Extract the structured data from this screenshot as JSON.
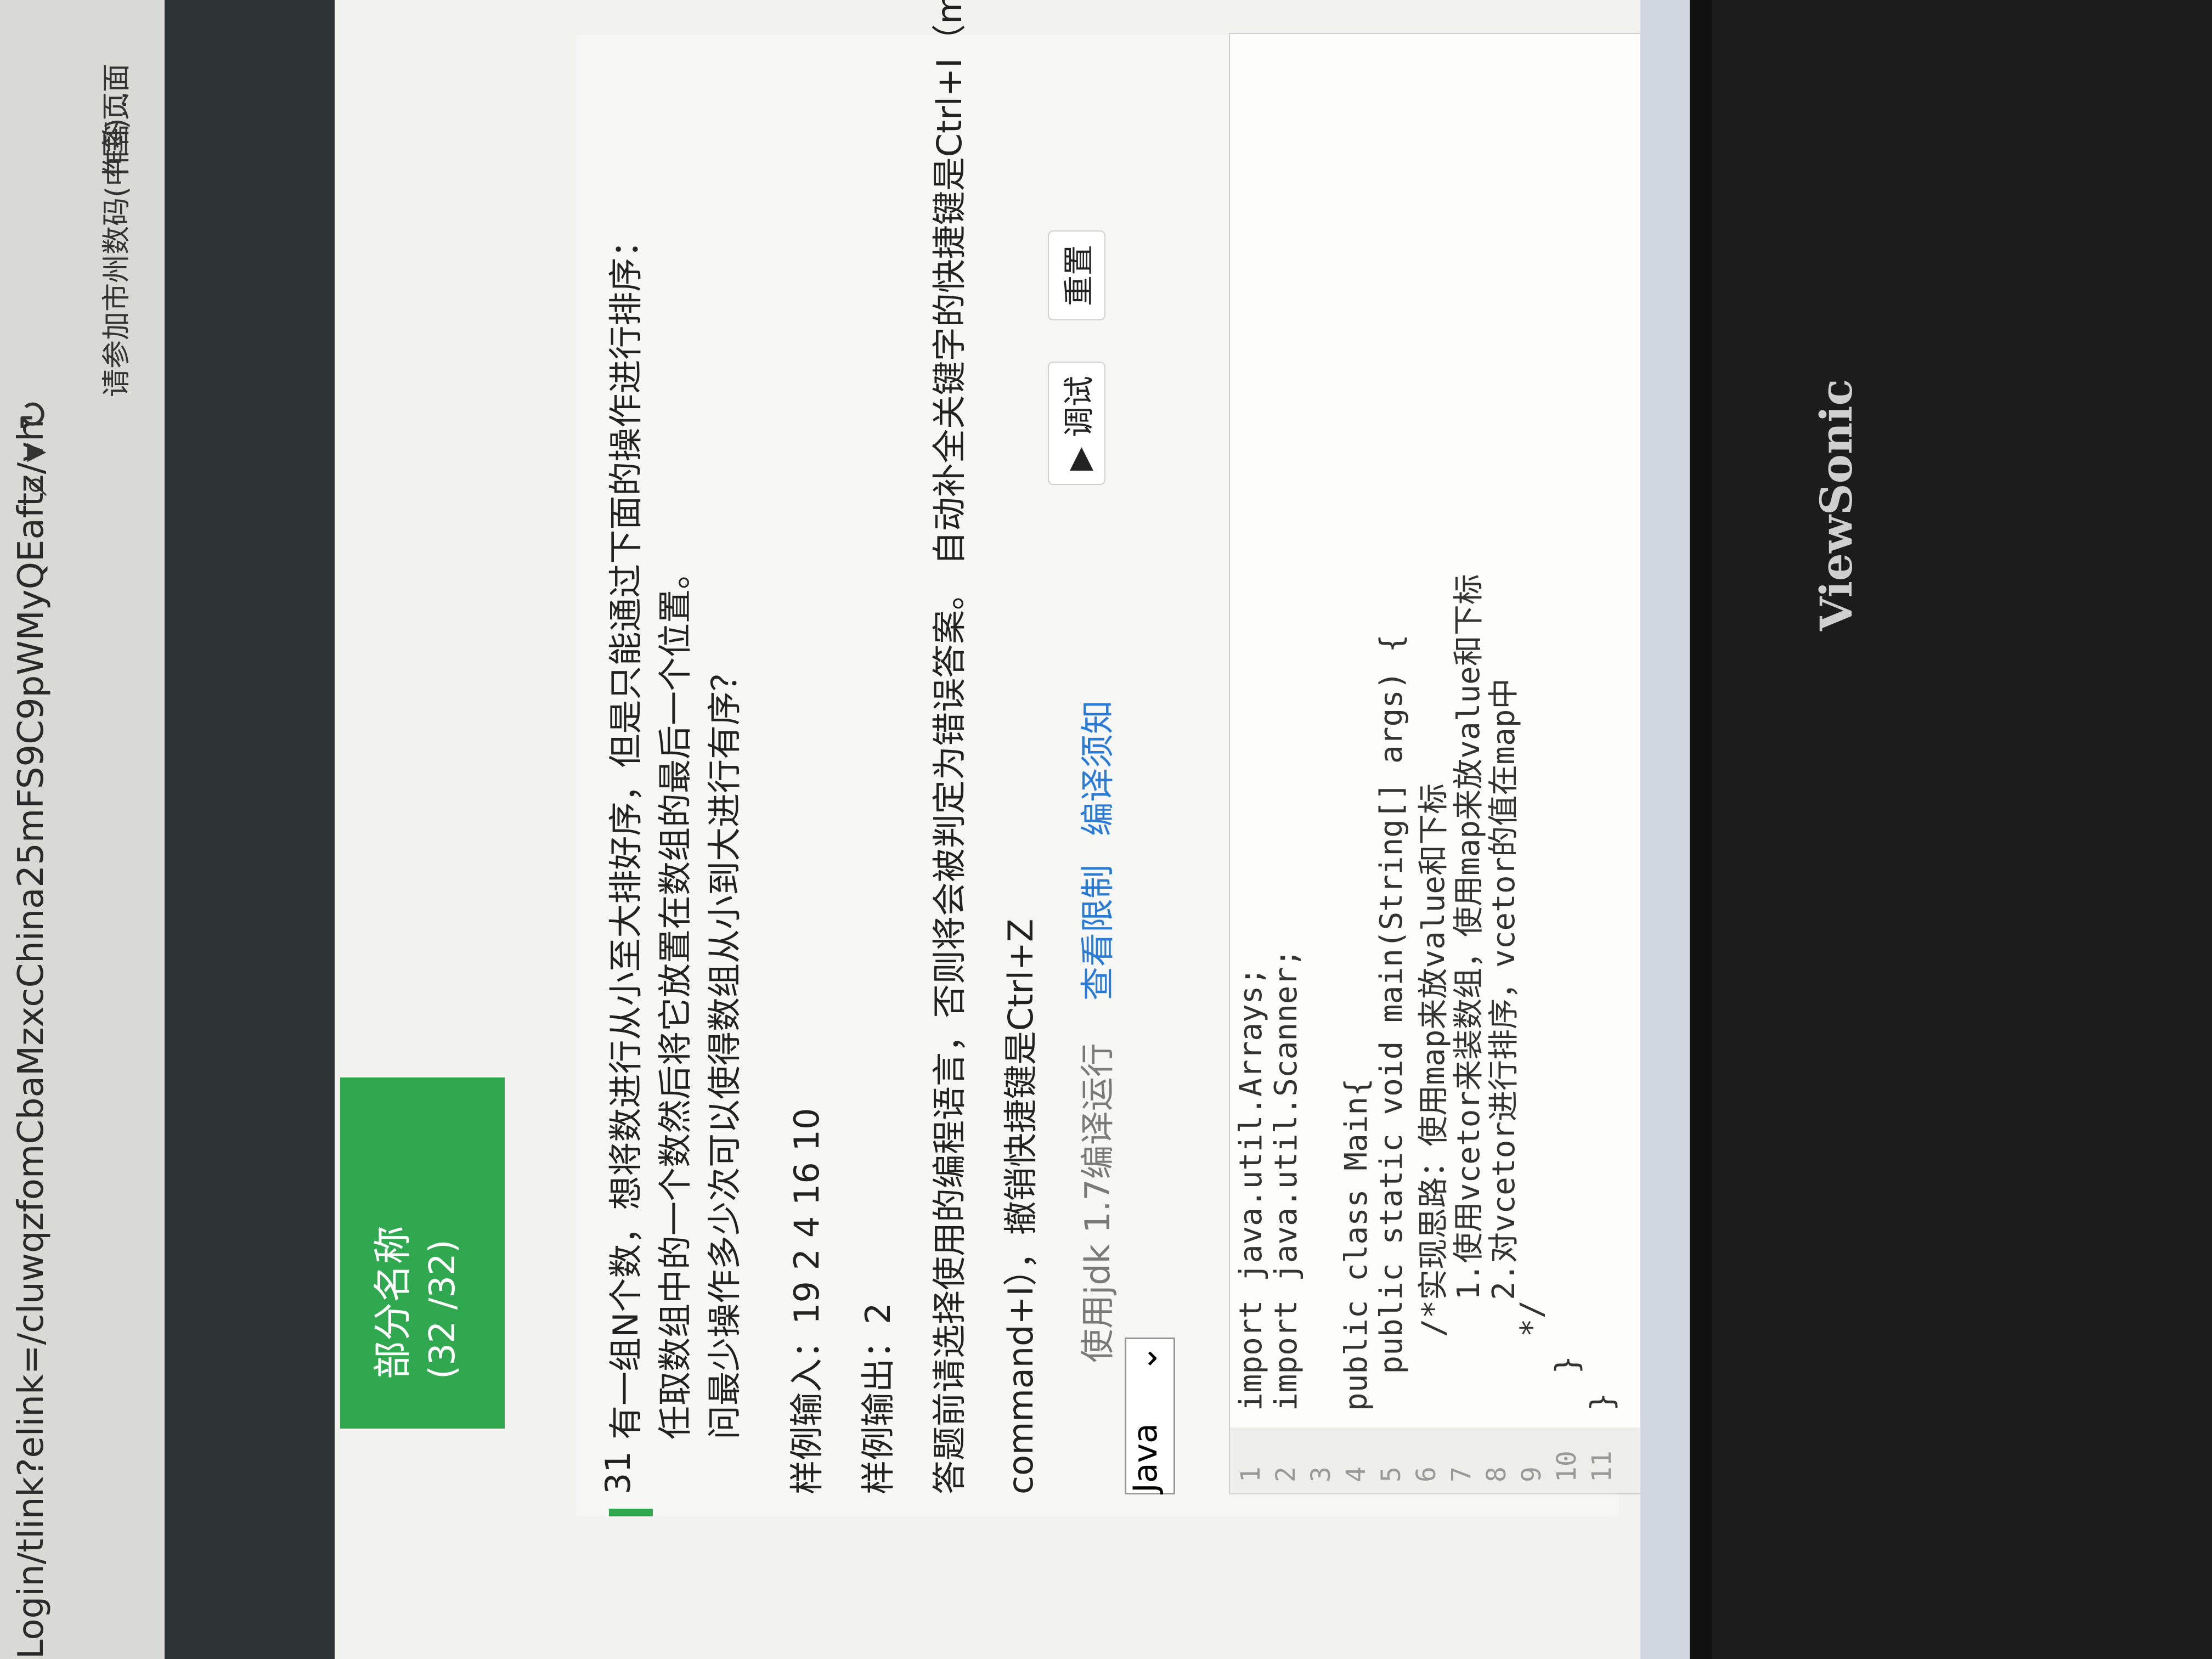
{
  "browser": {
    "address": "Login/tlink?elink=/cluwqzfomCbaMzxcChina25mFS9C9pWMyQEaftz/vh",
    "tab_1": "请参加市州数码(中国)...",
    "tab_2": "作答页面"
  },
  "section": {
    "name": "部分名称",
    "progress": "(32 /32)"
  },
  "question": {
    "number": "31",
    "text_lines": [
      "有一组N个数，想将数进行从小至大排好序，但是只能通过下面的操作进行排序：",
      "任取数组中的一个数然后将它放置在数组的最后一个位置。",
      "问最少操作多少次可以使得数组从小到大进行有序？"
    ],
    "sample_input_label": "样例输入：19 2 4 16 10",
    "sample_output_label": "样例输出：2",
    "notice": "答题前请选择使用的编程语言，否则将会被判定为错误答案。 自动补全关键字的快捷键是Ctrl+I（mac系统是",
    "notice_2": "command+I），撤销快捷键是Ctrl+Z"
  },
  "toolbar": {
    "language": "Java",
    "jdk_note": "使用jdk 1.7编译运行",
    "view_limits": "查看限制",
    "compile_notes": "编译须知",
    "debug_button": "▶ 调试",
    "reset_button": "重置"
  },
  "editor": {
    "lines": [
      "import java.util.Arrays;",
      "import java.util.Scanner;",
      "",
      "public class Main{",
      "  public static void main(String[] args) {",
      "    /*实现思路：使用map来放value和下标",
      "      1.使用vcetor来装数组，使用map来放value和下标",
      "      2.对vcetor进行排序，vcetor的值在map中",
      "    */",
      "  }",
      "}"
    ]
  },
  "monitor": {
    "brand": "ViewSonic"
  }
}
